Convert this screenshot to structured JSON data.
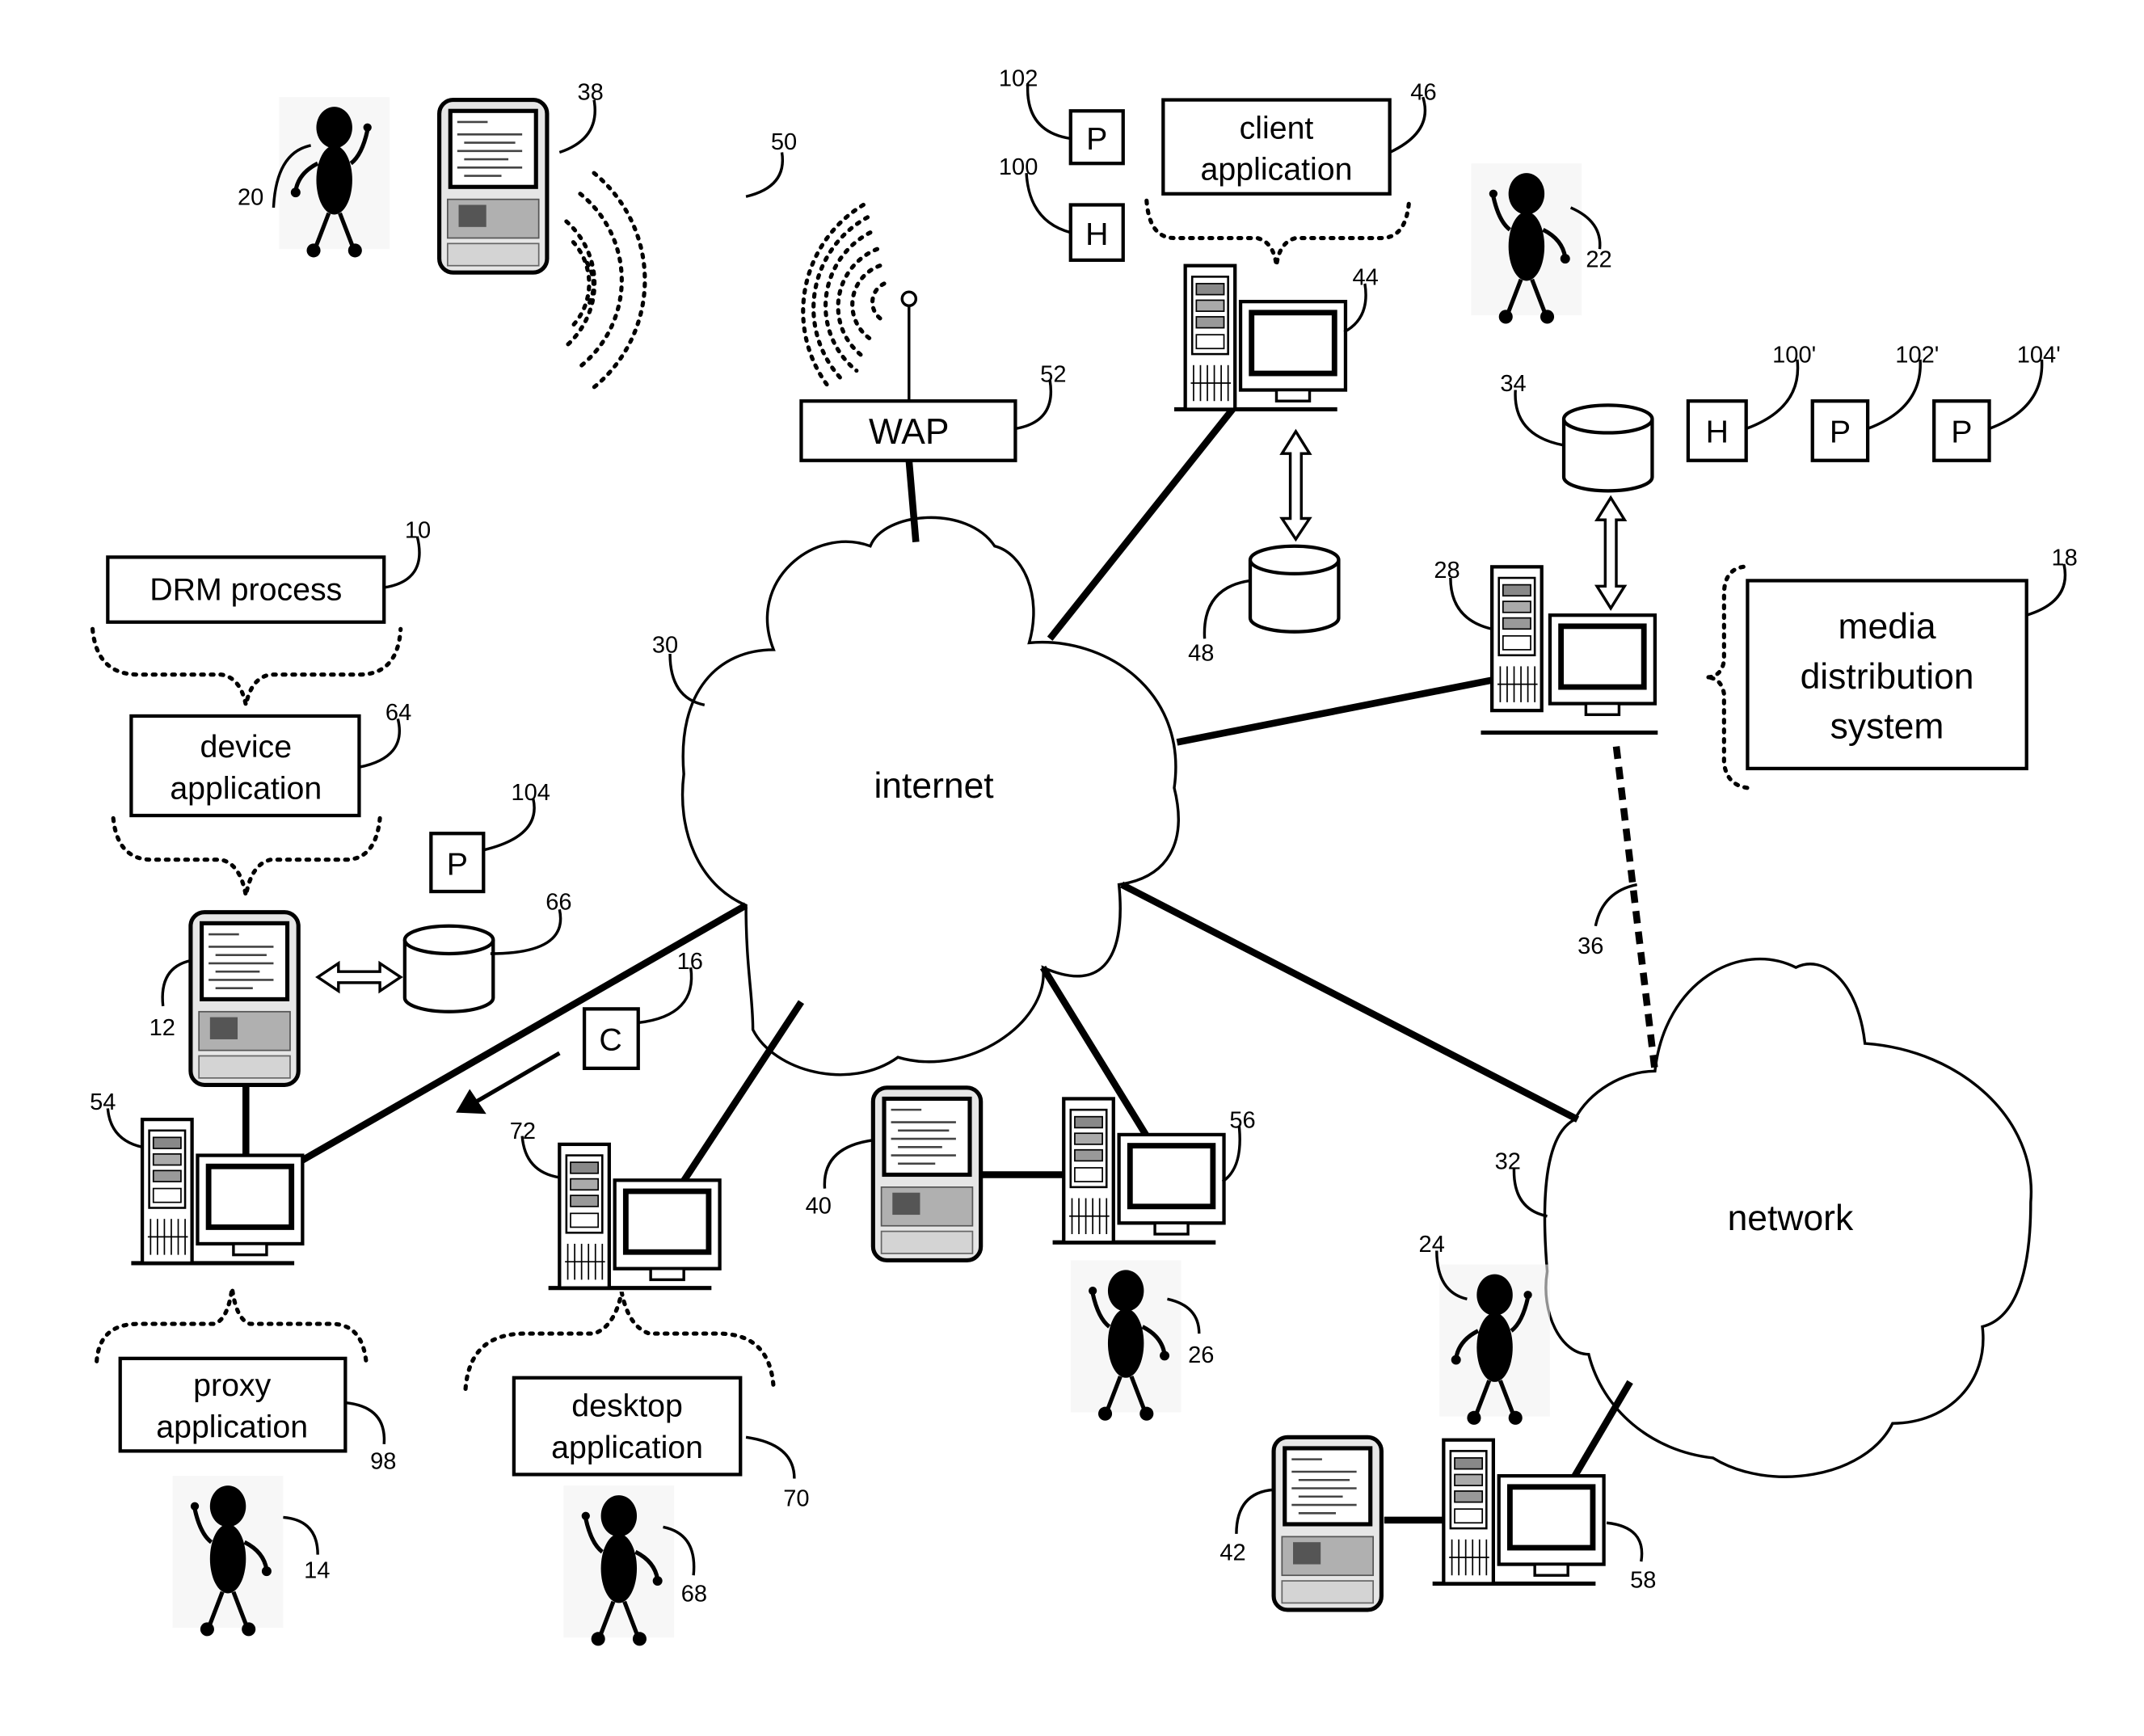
{
  "diagram": {
    "title": "",
    "nodes": {
      "drm_process": {
        "text": "DRM process",
        "ref": "10"
      },
      "device_application": {
        "line1": "device",
        "line2": "application",
        "ref": "64"
      },
      "client_application": {
        "line1": "client",
        "line2": "application",
        "ref": "46"
      },
      "media_distribution_system": {
        "line1": "media",
        "line2": "distribution",
        "line3": "system",
        "ref": "18"
      },
      "proxy_application": {
        "line1": "proxy",
        "line2": "application",
        "ref": "98"
      },
      "desktop_application": {
        "line1": "desktop",
        "line2": "application",
        "ref": "70"
      },
      "wap": {
        "text": "WAP",
        "ref": "52"
      },
      "internet": {
        "text": "internet",
        "ref": "30"
      },
      "network": {
        "text": "network",
        "ref": "32"
      },
      "wireless_signal": {
        "ref": "50"
      },
      "network_link_36": {
        "ref": "36"
      },
      "content_c": {
        "text": "C",
        "ref": "16"
      },
      "header_h_100": {
        "text": "H",
        "ref": "100"
      },
      "payload_p_102": {
        "text": "P",
        "ref": "102"
      },
      "payload_p_104": {
        "text": "P",
        "ref": "104"
      },
      "header_h_100p": {
        "text": "H",
        "ref": "100'"
      },
      "payload_p_102p": {
        "text": "P",
        "ref": "102'"
      },
      "payload_p_104p": {
        "text": "P",
        "ref": "104'"
      },
      "db_48": {
        "ref": "48"
      },
      "db_34": {
        "ref": "34"
      },
      "db_66": {
        "ref": "66"
      },
      "server_28": {
        "ref": "28"
      },
      "computer_44": {
        "ref": "44"
      },
      "computer_54": {
        "ref": "54"
      },
      "computer_72": {
        "ref": "72"
      },
      "computer_56": {
        "ref": "56"
      },
      "computer_58": {
        "ref": "58"
      },
      "device_38": {
        "ref": "38"
      },
      "device_12": {
        "ref": "12"
      },
      "device_40": {
        "ref": "40"
      },
      "device_42": {
        "ref": "42"
      },
      "user_20": {
        "ref": "20"
      },
      "user_22": {
        "ref": "22"
      },
      "user_14": {
        "ref": "14"
      },
      "user_68": {
        "ref": "68"
      },
      "user_26": {
        "ref": "26"
      },
      "user_24": {
        "ref": "24"
      }
    }
  }
}
